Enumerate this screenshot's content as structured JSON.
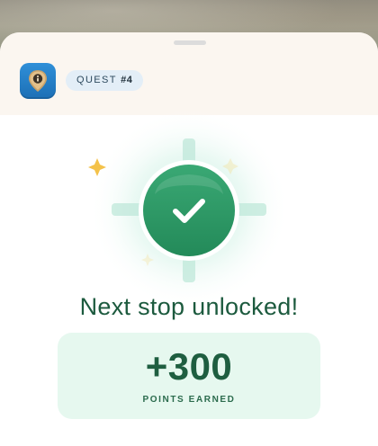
{
  "header": {
    "app_icon": "location-pin-info-icon",
    "quest_label": "QUEST",
    "quest_number": "#4"
  },
  "result": {
    "status_icon": "checkmark-icon",
    "headline": "Next stop unlocked!"
  },
  "points": {
    "value": "+300",
    "label": "POINTS EARNED"
  },
  "colors": {
    "accent_green": "#2f9e6a",
    "text_green": "#1c5a3e",
    "card_background": "#e6f8ef",
    "app_icon_blue": "#1c6fb5",
    "sparkle_yellow": "#f4c24a"
  }
}
